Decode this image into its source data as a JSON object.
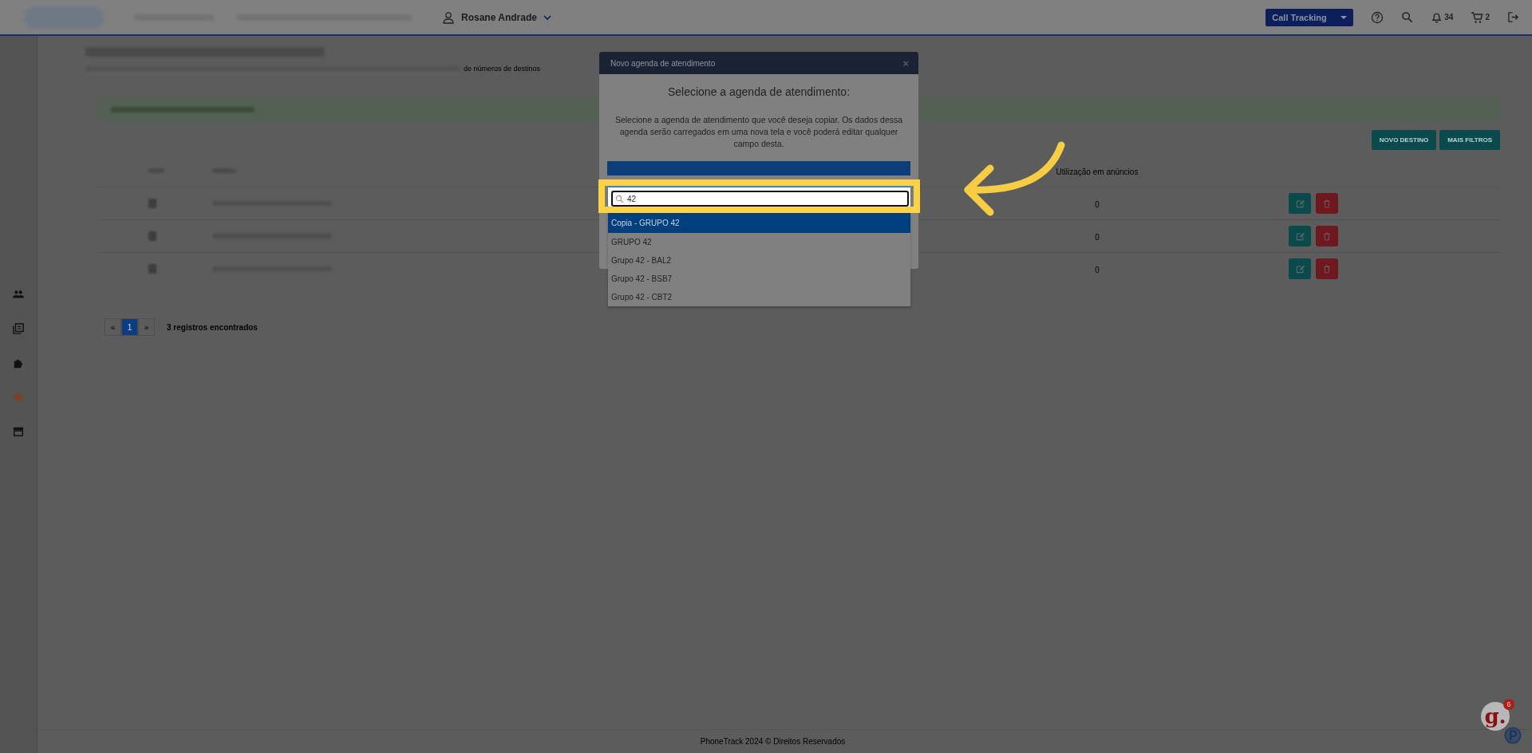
{
  "topbar": {
    "user_name": "Rosane Andrade",
    "product_select": "Call Tracking",
    "notifications_count": "34",
    "cart_count": "2"
  },
  "page": {
    "breadcrumb_tail": "de números de destinos",
    "buttons": [
      "NOVO DESTINO",
      "MAIS FILTROS"
    ],
    "table": {
      "columns": [
        {
          "label": "Utilização em anúncios"
        }
      ],
      "rows": [
        {
          "usage": "0"
        },
        {
          "usage": "0"
        },
        {
          "usage": "0"
        }
      ]
    },
    "pagination": {
      "prev": "«",
      "pages": [
        {
          "label": "1",
          "selected": true
        }
      ],
      "next": "»",
      "summary": "3 registros encontrados"
    }
  },
  "modal": {
    "title": "Novo agenda de atendimento",
    "close": "×",
    "heading": "Selecione a agenda de atendimento:",
    "description": "Selecione a agenda de atendimento que você deseja copiar. Os dados dessa agenda serão carregados em uma nova tela e você poderá editar qualquer campo desta.",
    "search": {
      "value": "42"
    },
    "options": [
      {
        "label": "Copia - GRUPO 42",
        "selected": true
      },
      {
        "label": "GRUPO 42",
        "selected": false
      },
      {
        "label": "Grupo 42 - BAL2",
        "selected": false
      },
      {
        "label": "Grupo 42 - BSB7",
        "selected": false
      },
      {
        "label": "Grupo 42 - CBT2",
        "selected": false
      }
    ]
  },
  "footer": "PhoneTrack 2024 © Direitos Reservados",
  "chat_logo": "g.",
  "chat_badge": "6"
}
